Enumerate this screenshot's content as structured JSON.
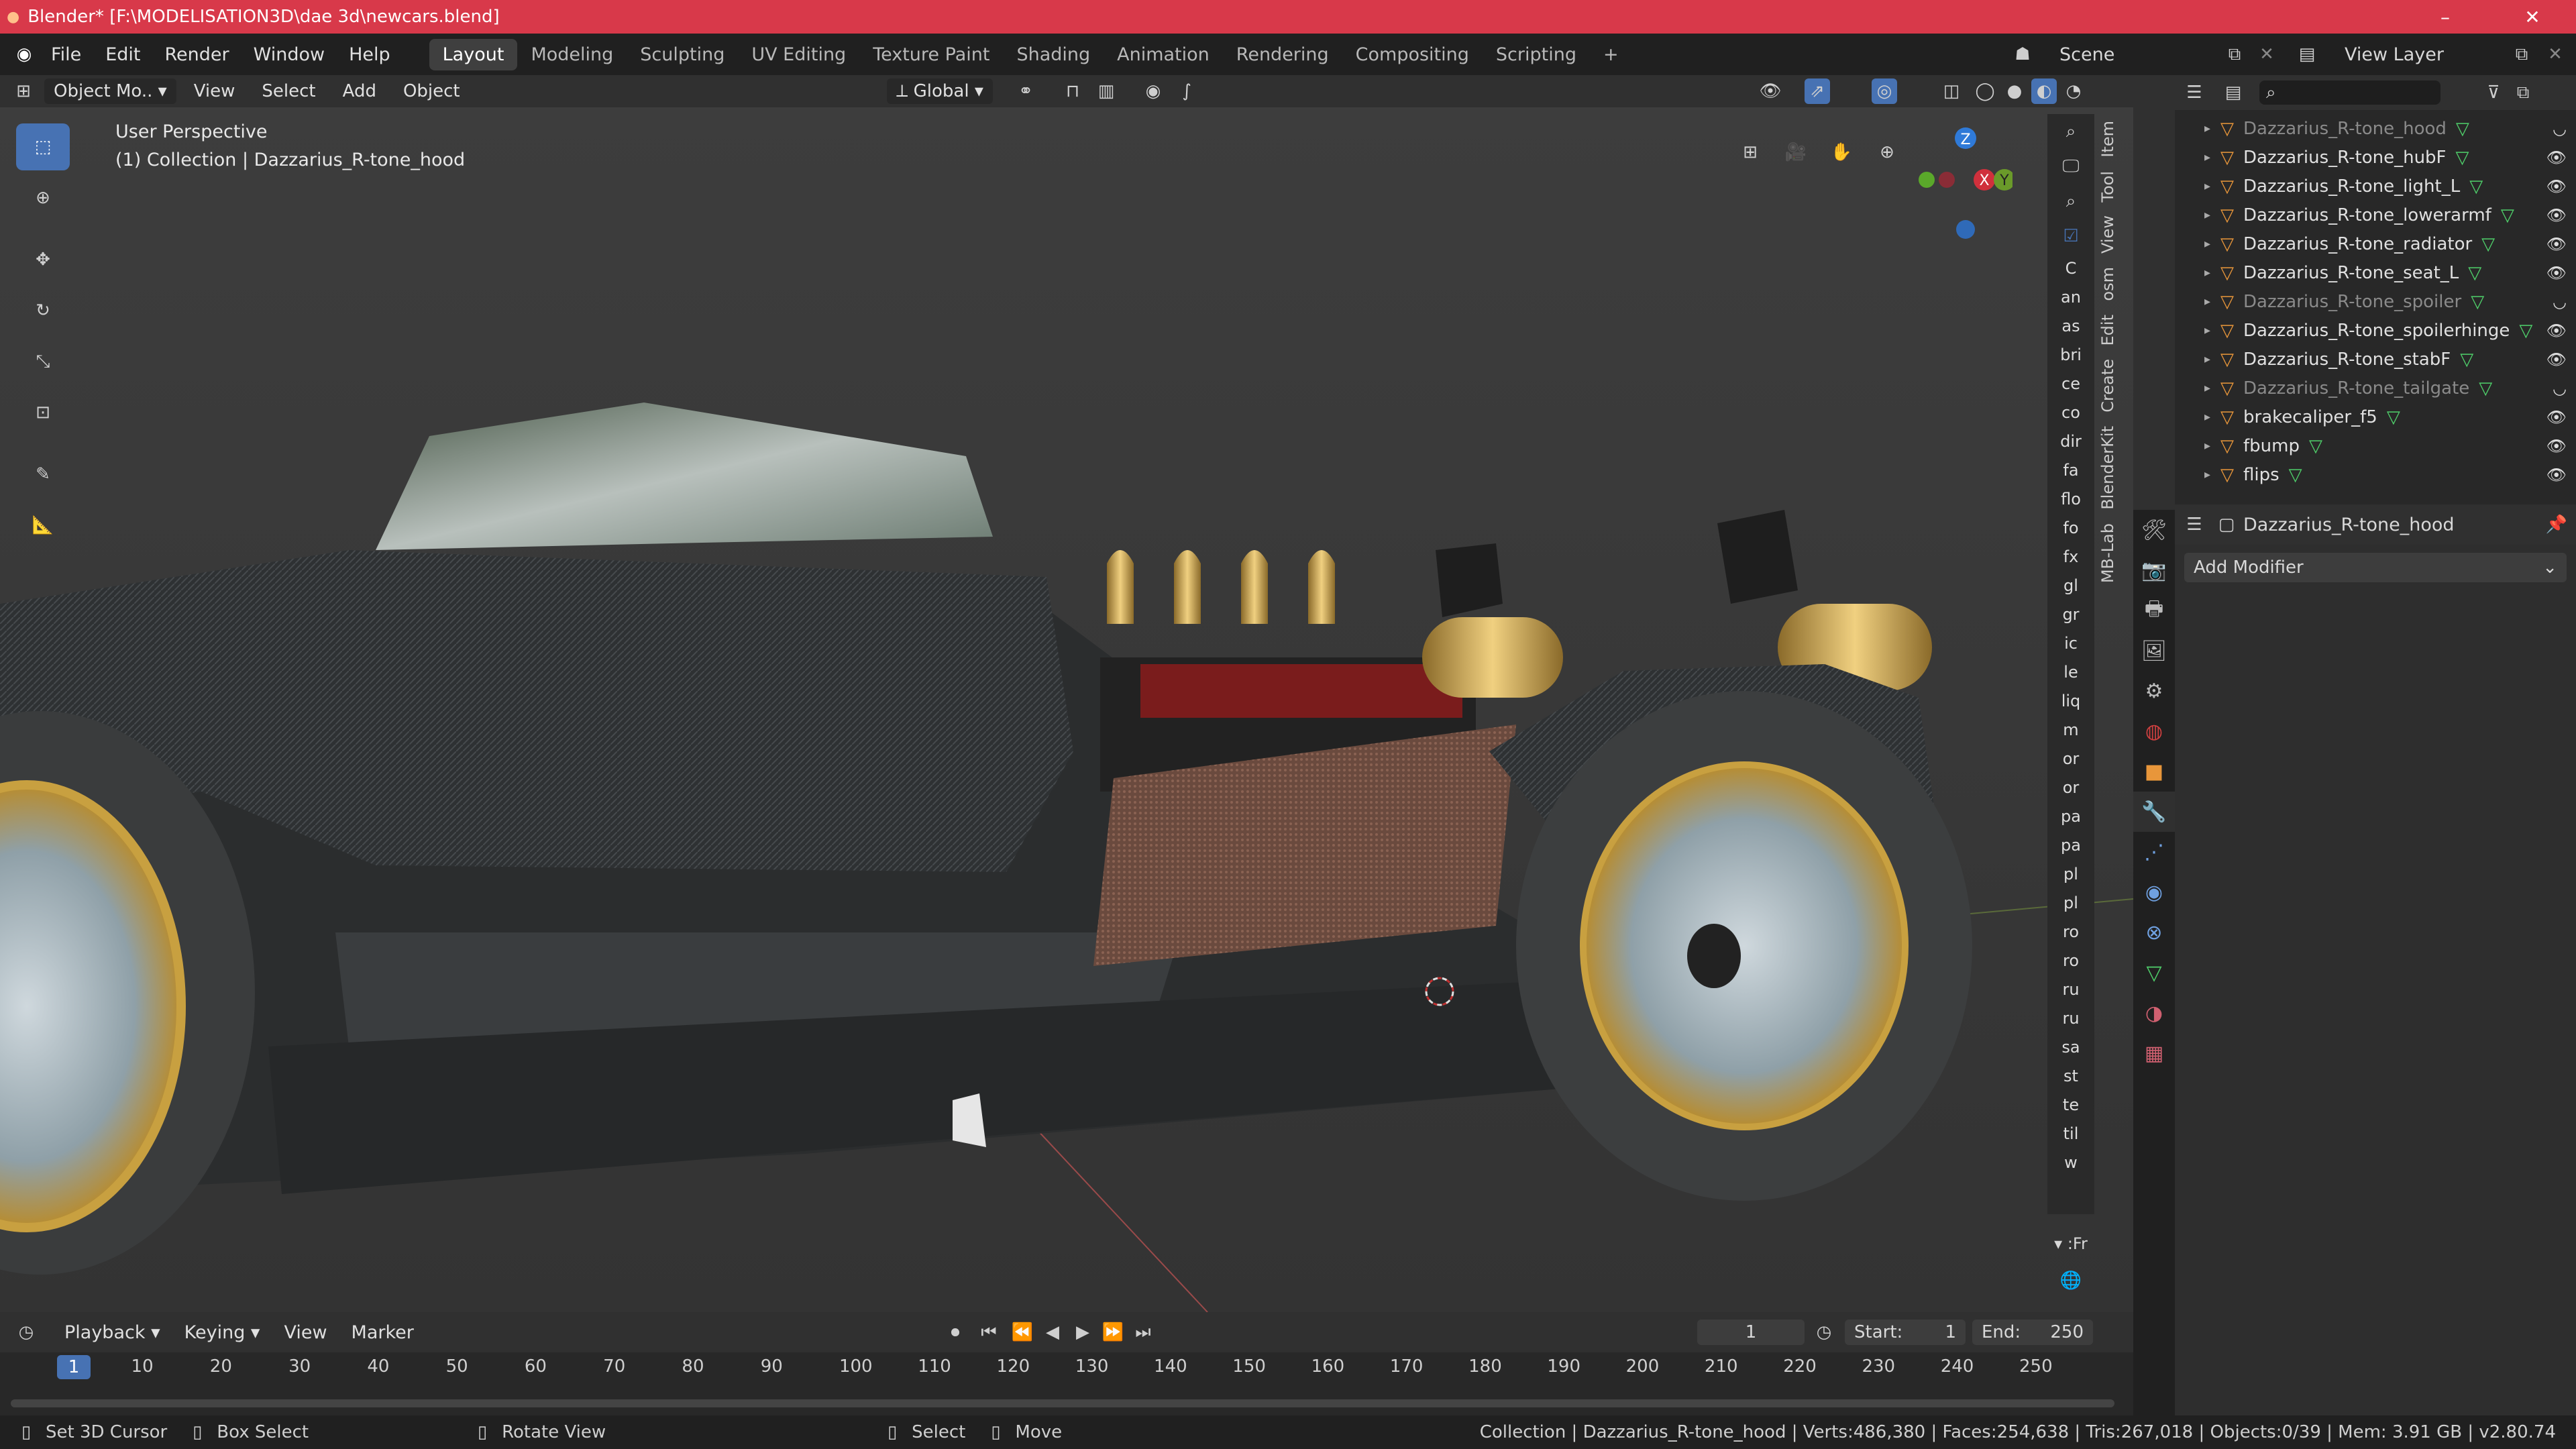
{
  "titlebar": {
    "title": "Blender* [F:\\MODELISATION3D\\dae 3d\\newcars.blend]",
    "minimize": "–",
    "restore": "❐",
    "close": "✕"
  },
  "menu": {
    "file": "File",
    "edit": "Edit",
    "render": "Render",
    "window": "Window",
    "help": "Help"
  },
  "workspaces": [
    "Layout",
    "Modeling",
    "Sculpting",
    "UV Editing",
    "Texture Paint",
    "Shading",
    "Animation",
    "Rendering",
    "Compositing",
    "Scripting",
    "+"
  ],
  "scene": {
    "label": "Scene",
    "view_layer": "View Layer"
  },
  "viewport_header": {
    "mode": "Object Mo..",
    "view": "View",
    "select": "Select",
    "add": "Add",
    "object": "Object",
    "transform": "Global"
  },
  "viewport": {
    "perspective": "User Perspective",
    "collection": "(1) Collection | Dazzarius_R-tone_hood"
  },
  "gizmo": {
    "z": "Z",
    "x": "X",
    "y": "Y"
  },
  "npanel_tabs": [
    "Item",
    "Tool",
    "View",
    "osm",
    "Edit",
    "Create",
    "BlenderKit",
    "MB-Lab"
  ],
  "addon_strip": [
    "C",
    "an",
    "as",
    "bri",
    "ce",
    "co",
    "dir",
    "fa",
    "flo",
    "fo",
    "fx",
    "gl",
    "gr",
    "ic",
    "le",
    "liq",
    "m",
    "or",
    "or",
    "pa",
    "pa",
    "pl",
    "pl",
    "ro",
    "ro",
    "ru",
    "ru",
    "sa",
    "st",
    "te",
    "til",
    "w"
  ],
  "addon_footer": "▾ :Fr",
  "outliner": {
    "rows": [
      {
        "name": "Dazzarius_R-tone_hood",
        "dim": true
      },
      {
        "name": "Dazzarius_R-tone_hubF",
        "dim": false
      },
      {
        "name": "Dazzarius_R-tone_light_L",
        "dim": false
      },
      {
        "name": "Dazzarius_R-tone_lowerarmf",
        "dim": false
      },
      {
        "name": "Dazzarius_R-tone_radiator",
        "dim": false
      },
      {
        "name": "Dazzarius_R-tone_seat_L",
        "dim": false
      },
      {
        "name": "Dazzarius_R-tone_spoiler",
        "dim": true
      },
      {
        "name": "Dazzarius_R-tone_spoilerhinge",
        "dim": false
      },
      {
        "name": "Dazzarius_R-tone_stabF",
        "dim": false
      },
      {
        "name": "Dazzarius_R-tone_tailgate",
        "dim": true
      },
      {
        "name": "brakecaliper_f5",
        "dim": false
      },
      {
        "name": "fbump",
        "dim": false
      },
      {
        "name": "flips",
        "dim": false
      }
    ]
  },
  "properties": {
    "object_name": "Dazzarius_R-tone_hood",
    "add_modifier": "Add Modifier"
  },
  "timeline": {
    "playback": "Playback",
    "keying": "Keying",
    "view": "View",
    "marker": "Marker",
    "current_frame": "1",
    "start_label": "Start:",
    "start": "1",
    "end_label": "End:",
    "end": "250",
    "ticks": [
      "1",
      "10",
      "20",
      "30",
      "40",
      "50",
      "60",
      "70",
      "80",
      "90",
      "100",
      "110",
      "120",
      "130",
      "140",
      "150",
      "160",
      "170",
      "180",
      "190",
      "200",
      "210",
      "220",
      "230",
      "240",
      "250"
    ]
  },
  "status": {
    "set_cursor": "Set 3D Cursor",
    "box_select": "Box Select",
    "rotate": "Rotate View",
    "select": "Select",
    "move": "Move",
    "stats": "Collection | Dazzarius_R-tone_hood | Verts:486,380 | Faces:254,638 | Tris:267,018 | Objects:0/39 | Mem: 3.91 GB | v2.80.74"
  },
  "colors": {
    "titlebar": "#d8394a",
    "accent": "#4772b3",
    "mesh_icon": "#e8963a",
    "data_icon": "#4fcf6a",
    "frame_marker": "#4772b3"
  }
}
